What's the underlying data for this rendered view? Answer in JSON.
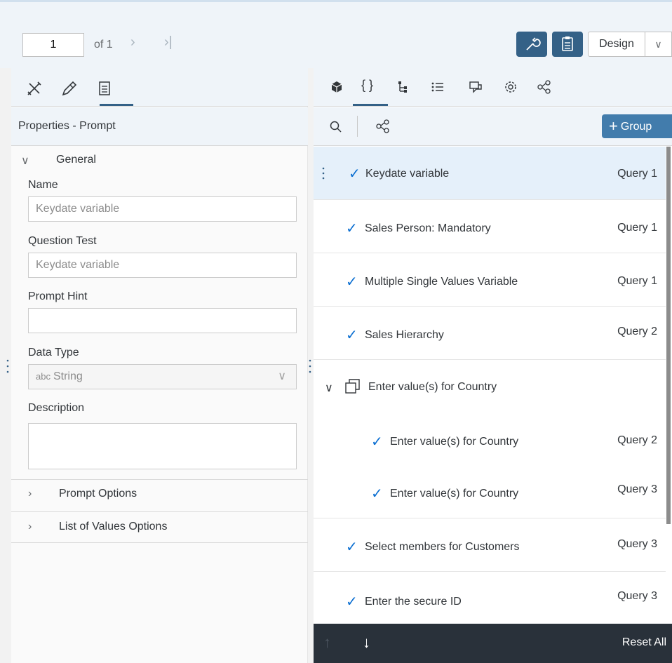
{
  "toolbar": {
    "page_value": "1",
    "of_text": "of 1",
    "next_icon": "chevron-right-icon",
    "last_icon": "last-page-icon",
    "design_label": "Design",
    "colors": {
      "accent": "#346187",
      "header_bg": "#eff4f9"
    }
  },
  "left_panel": {
    "tabs": [
      "tools-icon",
      "format-icon",
      "clipboard-icon"
    ],
    "title": "Properties - Prompt",
    "general": {
      "header": "General",
      "name_label": "Name",
      "name_value": "Keydate variable",
      "question_label": "Question Test",
      "question_value": "Keydate variable",
      "hint_label": "Prompt Hint",
      "hint_value": "",
      "datatype_label": "Data Type",
      "datatype_prefix": "abc",
      "datatype_value": "String",
      "description_label": "Description"
    },
    "sections": {
      "prompt_options": "Prompt Options",
      "lov_options": "List of Values Options"
    }
  },
  "right_panel": {
    "tabs": [
      "cube-icon",
      "braces-icon",
      "hierarchy-icon",
      "list-icon",
      "chat-icon",
      "gear-icon",
      "share-icon"
    ],
    "group_label": "Group",
    "items": [
      {
        "label": "Keydate variable",
        "query": "Query 1"
      },
      {
        "label": "Sales Person: Mandatory",
        "query": "Query 1"
      },
      {
        "label": "Multiple Single Values Variable",
        "query": "Query 1"
      },
      {
        "label": "Sales Hierarchy",
        "query": "Query 2"
      },
      {
        "label": "Enter value(s) for Country",
        "query": ""
      },
      {
        "label": "Enter value(s) for Country",
        "query": "Query 2"
      },
      {
        "label": "Enter value(s) for Country",
        "query": "Query 3"
      },
      {
        "label": "Select members for Customers",
        "query": "Query 3"
      },
      {
        "label": "Enter the secure ID",
        "query": "Query 3"
      }
    ]
  },
  "bottom_bar": {
    "reset_label": "Reset All"
  }
}
